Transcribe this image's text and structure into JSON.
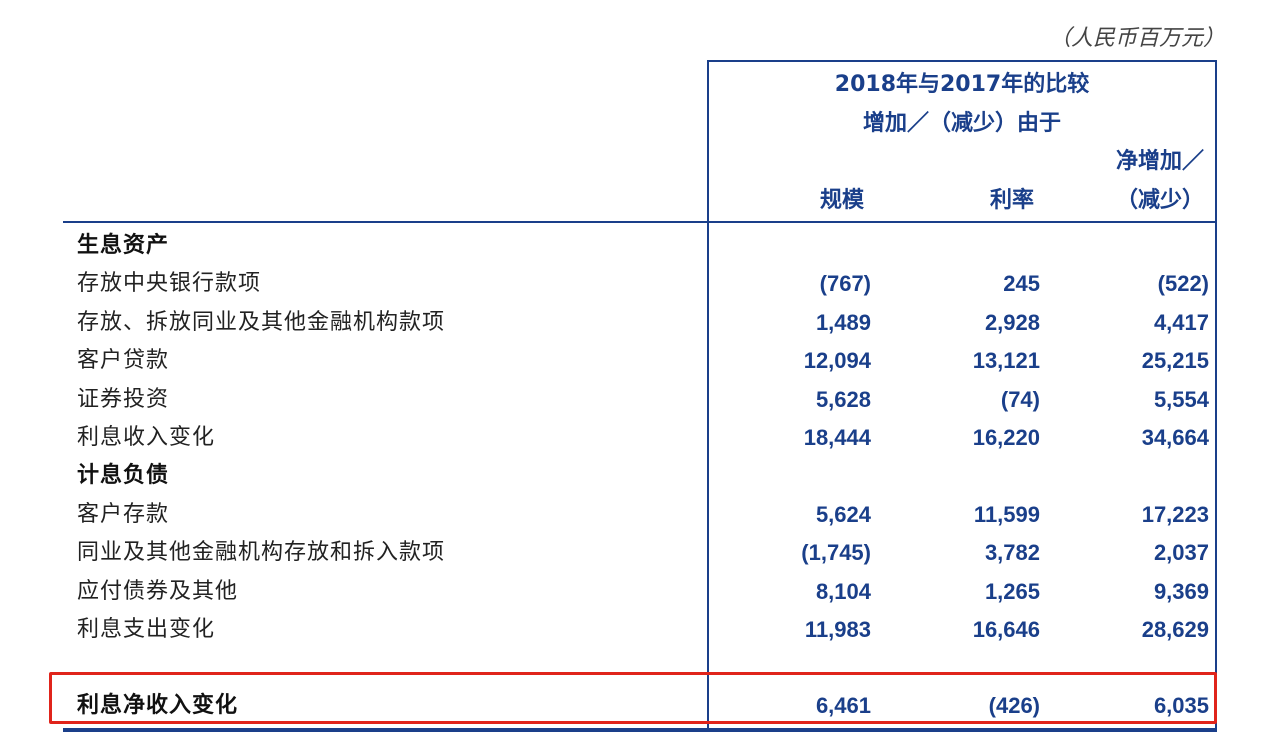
{
  "unit_note": "（人民币百万元）",
  "header": {
    "line1": "2018年与2017年的比较",
    "line2": "增加／（减少）由于",
    "col_scale": "规模",
    "col_rate": "利率",
    "col_net_line1": "净增加／",
    "col_net_line2": "（减少）"
  },
  "rows": [
    {
      "label": "生息资产",
      "section": true,
      "scale": "",
      "rate": "",
      "net": ""
    },
    {
      "label": "存放中央银行款项",
      "section": false,
      "scale": "(767)",
      "rate": "245",
      "net": "(522)"
    },
    {
      "label": "存放、拆放同业及其他金融机构款项",
      "section": false,
      "scale": "1,489",
      "rate": "2,928",
      "net": "4,417"
    },
    {
      "label": "客户贷款",
      "section": false,
      "scale": "12,094",
      "rate": "13,121",
      "net": "25,215"
    },
    {
      "label": "证券投资",
      "section": false,
      "scale": "5,628",
      "rate": "(74)",
      "net": "5,554"
    },
    {
      "label": "利息收入变化",
      "section": false,
      "scale": "18,444",
      "rate": "16,220",
      "net": "34,664"
    },
    {
      "label": "计息负债",
      "section": true,
      "scale": "",
      "rate": "",
      "net": ""
    },
    {
      "label": "客户存款",
      "section": false,
      "scale": "5,624",
      "rate": "11,599",
      "net": "17,223"
    },
    {
      "label": "同业及其他金融机构存放和拆入款项",
      "section": false,
      "scale": "(1,745)",
      "rate": "3,782",
      "net": "2,037"
    },
    {
      "label": "应付债券及其他",
      "section": false,
      "scale": "8,104",
      "rate": "1,265",
      "net": "9,369"
    },
    {
      "label": "利息支出变化",
      "section": false,
      "scale": "11,983",
      "rate": "16,646",
      "net": "28,629"
    }
  ],
  "total": {
    "label": "利息净收入变化",
    "scale": "6,461",
    "rate": "(426)",
    "net": "6,035"
  },
  "colors": {
    "accent": "#1a3f8a",
    "highlight": "#e0241b"
  }
}
